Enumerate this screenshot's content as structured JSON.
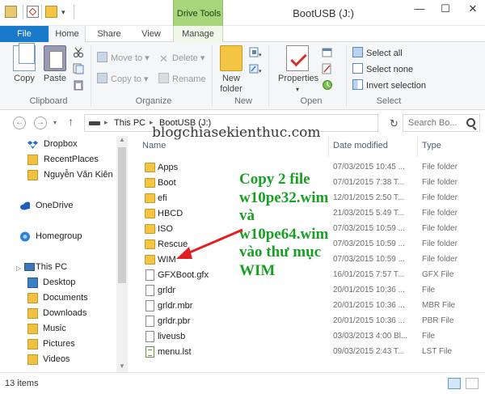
{
  "window": {
    "title": "BootUSB (J:)",
    "context_tab_group": "Drive Tools",
    "min_glyph": "—",
    "max_glyph": "☐",
    "close_glyph": "✕"
  },
  "qat": {
    "dropdown_glyph": "▾"
  },
  "ribbon_tabs": {
    "file": "File",
    "home": "Home",
    "share": "Share",
    "view": "View",
    "manage": "Manage"
  },
  "ribbon": {
    "clipboard": {
      "label": "Clipboard",
      "copy": "Copy",
      "paste": "Paste"
    },
    "organize": {
      "label": "Organize",
      "move_to": "Move to ▾",
      "copy_to": "Copy to ▾",
      "delete": "Delete ▾",
      "rename": "Rename"
    },
    "new": {
      "label": "New",
      "new_folder_line1": "New",
      "new_folder_line2": "folder"
    },
    "open": {
      "label": "Open",
      "properties": "Properties",
      "properties_arrow": "▾"
    },
    "select": {
      "label": "Select",
      "select_all": "Select all",
      "select_none": "Select none",
      "invert_selection": "Invert selection"
    },
    "icons": {
      "cut": "scissors-icon",
      "copy_path": "copy-path-icon",
      "shortcut": "paste-shortcut-icon"
    }
  },
  "address": {
    "back_glyph": "←",
    "forward_glyph": "→",
    "history_glyph": "▾",
    "up_glyph": "↑",
    "sep_glyph": "▸",
    "crumbs": [
      "This PC",
      "BootUSB (J:)"
    ],
    "dropdown_glyph": "▾",
    "refresh_glyph": "↻",
    "search_placeholder": "Search Bo..."
  },
  "nav": {
    "items": [
      {
        "label": "Dropbox",
        "icon": "dropbox-icon",
        "color": "#1a6fd6"
      },
      {
        "label": "RecentPlaces",
        "icon": "recent-places-icon",
        "color": "#f0c040"
      },
      {
        "label": "Nguyễn Văn Kiên",
        "icon": "user-folder-icon",
        "color": "#f0c040"
      },
      {
        "label": "OneDrive",
        "icon": "onedrive-icon",
        "color": "#1f5fb8"
      },
      {
        "label": "Homegroup",
        "icon": "homegroup-icon",
        "color": "#2f7ed8"
      },
      {
        "label": "This PC",
        "icon": "this-pc-icon",
        "color": "#3f76b8"
      },
      {
        "label": "Desktop",
        "icon": "desktop-folder-icon",
        "color": "#3b7fc4"
      },
      {
        "label": "Documents",
        "icon": "documents-folder-icon",
        "color": "#f0c040"
      },
      {
        "label": "Downloads",
        "icon": "downloads-folder-icon",
        "color": "#2f7ed8"
      },
      {
        "label": "Music",
        "icon": "music-folder-icon",
        "color": "#f0c040"
      },
      {
        "label": "Pictures",
        "icon": "pictures-folder-icon",
        "color": "#f0c040"
      },
      {
        "label": "Videos",
        "icon": "videos-folder-icon",
        "color": "#f0c040"
      }
    ],
    "expander_glyph": "▷",
    "scroll_up_glyph": "▲",
    "scroll_down_glyph": "▼"
  },
  "columns": {
    "name": "Name",
    "date": "Date modified",
    "type": "Type",
    "sort_glyph": "^"
  },
  "files": [
    {
      "name": "Apps",
      "date": "07/03/2015 10:45 ...",
      "type": "File folder",
      "kind": "folder"
    },
    {
      "name": "Boot",
      "date": "07/01/2015 7:38 T...",
      "type": "File folder",
      "kind": "folder"
    },
    {
      "name": "efi",
      "date": "12/01/2015 2:50 T...",
      "type": "File folder",
      "kind": "folder"
    },
    {
      "name": "HBCD",
      "date": "21/03/2015 5:49 T...",
      "type": "File folder",
      "kind": "folder"
    },
    {
      "name": "ISO",
      "date": "07/03/2015 10:59 ...",
      "type": "File folder",
      "kind": "folder"
    },
    {
      "name": "Rescue",
      "date": "07/03/2015 10:59 ...",
      "type": "File folder",
      "kind": "folder"
    },
    {
      "name": "WIM",
      "date": "07/03/2015 10:59 ...",
      "type": "File folder",
      "kind": "folder"
    },
    {
      "name": "GFXBoot.gfx",
      "date": "16/01/2015 7:57 T...",
      "type": "GFX File",
      "kind": "file"
    },
    {
      "name": "grldr",
      "date": "20/01/2015 10:36 ...",
      "type": "File",
      "kind": "file"
    },
    {
      "name": "grldr.mbr",
      "date": "20/01/2015 10:36 ...",
      "type": "MBR File",
      "kind": "file"
    },
    {
      "name": "grldr.pbr",
      "date": "20/01/2015 10:36 ...",
      "type": "PBR File",
      "kind": "file"
    },
    {
      "name": "liveusb",
      "date": "03/03/2013 4:00 Bl...",
      "type": "File",
      "kind": "file"
    },
    {
      "name": "menu.lst",
      "date": "09/03/2015 2:43 T...",
      "type": "LST File",
      "kind": "lst"
    }
  ],
  "overlay": {
    "watermark": "blogchiasekienthuc.com",
    "annotation": "Copy 2 file\nw10pe32.wim\nvà\nw10pe64.wim\nvào thư mục\nWIM",
    "annotation_color": "#18a025",
    "arrow_color": "#e02020"
  },
  "status": {
    "item_count": "13 items"
  },
  "colors": {
    "file_tab": "#1979ca",
    "drive_tools": "#a8d47c",
    "accent": "#1979ca"
  }
}
